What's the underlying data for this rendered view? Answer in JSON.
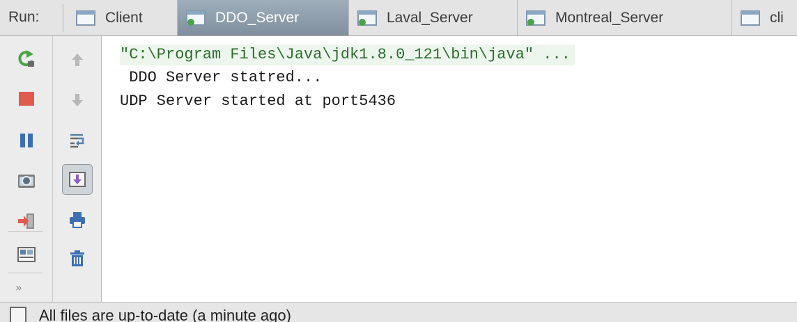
{
  "run_panel": {
    "label": "Run:",
    "tabs": [
      {
        "label": "Client",
        "active": false,
        "running": false
      },
      {
        "label": "DDO_Server",
        "active": true,
        "running": true
      },
      {
        "label": "Laval_Server",
        "active": false,
        "running": true
      },
      {
        "label": "Montreal_Server",
        "active": false,
        "running": true
      },
      {
        "label": "cli",
        "active": false,
        "running": false
      }
    ]
  },
  "left_toolbar": {
    "buttons": [
      {
        "name": "rerun-icon"
      },
      {
        "name": "stop-icon"
      },
      {
        "name": "pause-icon"
      },
      {
        "name": "dump-threads-icon"
      },
      {
        "name": "exit-icon"
      },
      {
        "name": "restore-layout-icon"
      },
      {
        "name": "more-icon",
        "glyph": "»"
      }
    ]
  },
  "right_toolbar": {
    "buttons": [
      {
        "name": "up-arrow-icon"
      },
      {
        "name": "down-arrow-icon"
      },
      {
        "name": "soft-wrap-icon"
      },
      {
        "name": "scroll-to-end-icon",
        "toggled": true
      },
      {
        "name": "print-icon"
      },
      {
        "name": "trash-icon"
      }
    ]
  },
  "console": {
    "lines": [
      "\"C:\\Program Files\\Java\\jdk1.8.0_121\\bin\\java\" ...",
      " DDO Server statred...",
      "UDP Server started at port5436"
    ]
  },
  "status_bar": {
    "text": "All files are up-to-date (a minute ago)"
  },
  "colors": {
    "active_tab": "#8796a4",
    "stop": "#e05a4f",
    "pause": "#3d6fb3",
    "rerun": "#4aa347",
    "console_cmd_bg": "#ecf6ec"
  }
}
